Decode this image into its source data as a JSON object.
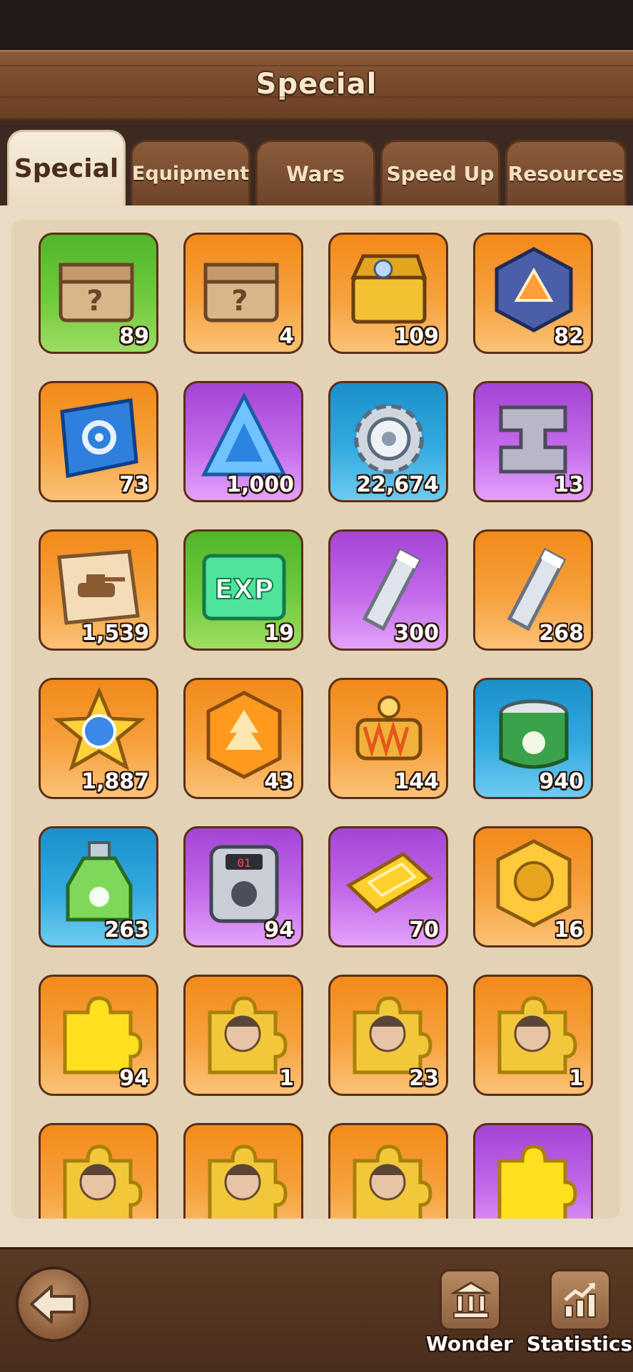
{
  "header": {
    "title": "Special"
  },
  "tabs": [
    {
      "label": "Special",
      "active": true
    },
    {
      "label": "Equipment",
      "active": false
    },
    {
      "label": "Wars",
      "active": false
    },
    {
      "label": "Speed Up",
      "active": false
    },
    {
      "label": "Resources",
      "active": false
    }
  ],
  "items": [
    {
      "name": "mystery-crate-fast",
      "color": "green",
      "count": "89",
      "icon": "crate-icon"
    },
    {
      "name": "mystery-crate-parts",
      "color": "orange",
      "count": "4",
      "icon": "crate-icon"
    },
    {
      "name": "treasure-chest",
      "color": "orange",
      "count": "109",
      "icon": "chest-icon"
    },
    {
      "name": "crystal-cube",
      "color": "orange",
      "count": "82",
      "icon": "cube-icon"
    },
    {
      "name": "gear-blueprint",
      "color": "orange",
      "count": "73",
      "icon": "scroll-gear-icon"
    },
    {
      "name": "blue-crystal",
      "color": "purple",
      "count": "1,000",
      "icon": "triangle-crystal-icon"
    },
    {
      "name": "steel-gear",
      "color": "blue",
      "count": "22,674",
      "icon": "gear-icon"
    },
    {
      "name": "metal-parts",
      "color": "purple",
      "count": "13",
      "icon": "metal-block-icon"
    },
    {
      "name": "tank-blueprint",
      "color": "orange",
      "count": "1,539",
      "icon": "tank-scroll-icon"
    },
    {
      "name": "exp-ticket",
      "color": "green",
      "count": "19",
      "icon": "exp-icon"
    },
    {
      "name": "steel-bar-purple",
      "color": "purple",
      "count": "300",
      "icon": "steel-bar-icon"
    },
    {
      "name": "steel-bar-orange",
      "color": "orange",
      "count": "268",
      "icon": "steel-bar-icon"
    },
    {
      "name": "star-medal",
      "color": "orange",
      "count": "1,887",
      "icon": "star-medal-icon"
    },
    {
      "name": "tree-coin",
      "color": "orange",
      "count": "43",
      "icon": "tree-coin-icon"
    },
    {
      "name": "energy-coil",
      "color": "orange",
      "count": "144",
      "icon": "coil-icon"
    },
    {
      "name": "pet-food-can",
      "color": "blue",
      "count": "940",
      "icon": "can-icon"
    },
    {
      "name": "pet-potion",
      "color": "blue",
      "count": "263",
      "icon": "potion-icon"
    },
    {
      "name": "pet-device",
      "color": "purple",
      "count": "94",
      "icon": "device-icon"
    },
    {
      "name": "gold-bars",
      "color": "purple",
      "count": "70",
      "icon": "gold-bar-icon"
    },
    {
      "name": "hero-medal",
      "color": "orange",
      "count": "16",
      "icon": "hero-medal-icon"
    },
    {
      "name": "puzzle-piece-gold",
      "color": "orange",
      "count": "94",
      "icon": "puzzle-icon"
    },
    {
      "name": "hero-fragment-1",
      "color": "orange",
      "count": "1",
      "icon": "puzzle-portrait-icon"
    },
    {
      "name": "hero-fragment-2",
      "color": "orange",
      "count": "23",
      "icon": "puzzle-portrait-icon"
    },
    {
      "name": "hero-fragment-3",
      "color": "orange",
      "count": "1",
      "icon": "puzzle-portrait-icon"
    },
    {
      "name": "hero-fragment-4",
      "color": "orange",
      "count": "",
      "icon": "puzzle-portrait-icon"
    },
    {
      "name": "hero-fragment-5",
      "color": "orange",
      "count": "",
      "icon": "puzzle-portrait-icon"
    },
    {
      "name": "hero-fragment-6",
      "color": "orange",
      "count": "",
      "icon": "puzzle-portrait-icon"
    },
    {
      "name": "puzzle-piece-purple",
      "color": "purple",
      "count": "",
      "icon": "puzzle-icon"
    }
  ],
  "bottom_nav": {
    "back_icon": "back-arrow-icon",
    "wonder_label": "Wonder",
    "statistics_label": "Statistics"
  },
  "colors": {
    "orange": "#f28a1a",
    "green": "#52b52a",
    "purple": "#a444d6",
    "blue": "#1b8fca",
    "wood": "#7a4b2c"
  }
}
